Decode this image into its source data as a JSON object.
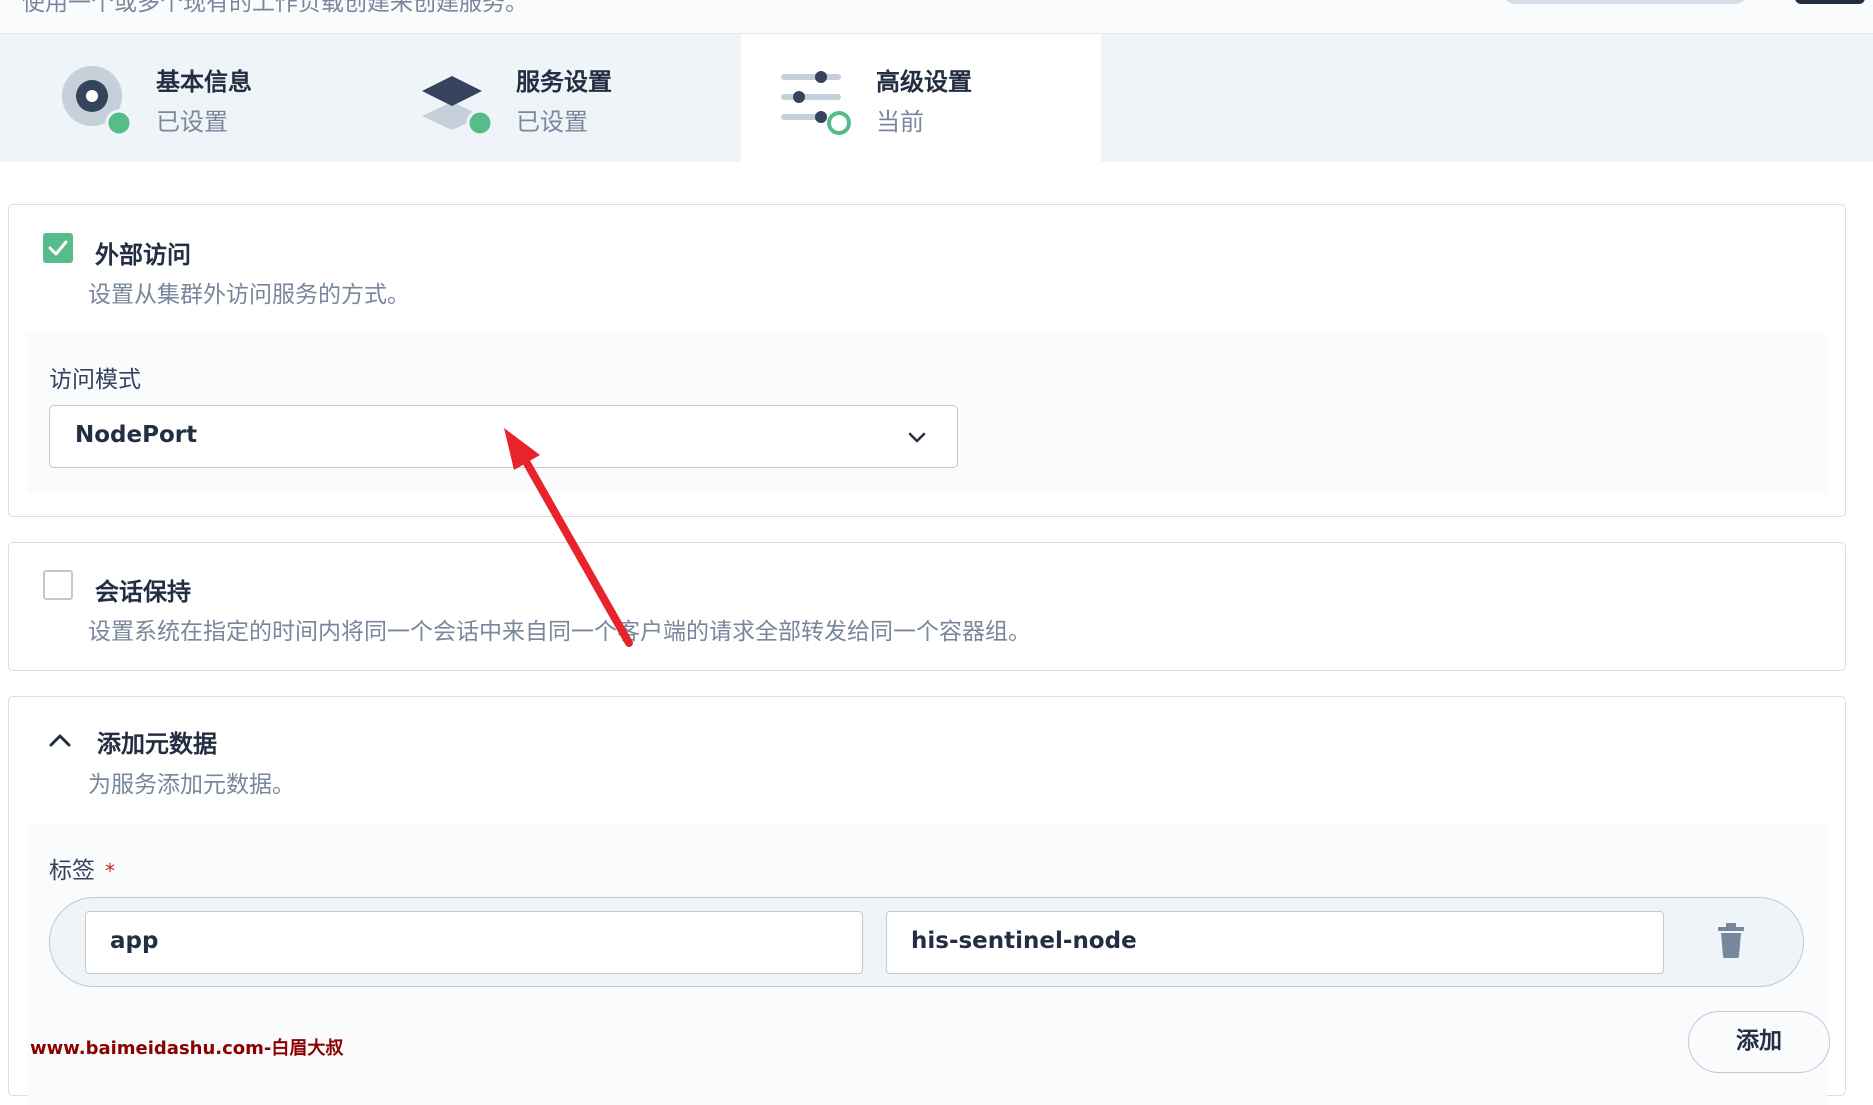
{
  "top": {
    "description": "使用一个或多个现有的工作负载创建来创建服务。"
  },
  "steps": [
    {
      "title": "基本信息",
      "status": "已设置"
    },
    {
      "title": "服务设置",
      "status": "已设置"
    },
    {
      "title": "高级设置",
      "status": "当前"
    }
  ],
  "external_access": {
    "checked": true,
    "title": "外部访问",
    "description": "设置从集群外访问服务的方式。",
    "mode_label": "访问模式",
    "mode_value": "NodePort"
  },
  "session_affinity": {
    "checked": false,
    "title": "会话保持",
    "description": "设置系统在指定的时间内将同一个会话中来自同一个客户端的请求全部转发给同一个容器组。"
  },
  "metadata": {
    "title": "添加元数据",
    "description": "为服务添加元数据。",
    "labels_label": "标签",
    "required_mark": "*",
    "labels": [
      {
        "key": "app",
        "value": "his-sentinel-node"
      }
    ],
    "add_label": "添加"
  },
  "watermark": "www.baimeidashu.com-白眉大叔",
  "colors": {
    "accent": "#55bc8a",
    "annotation_arrow": "#e8232b",
    "watermark": "#8b0000"
  }
}
